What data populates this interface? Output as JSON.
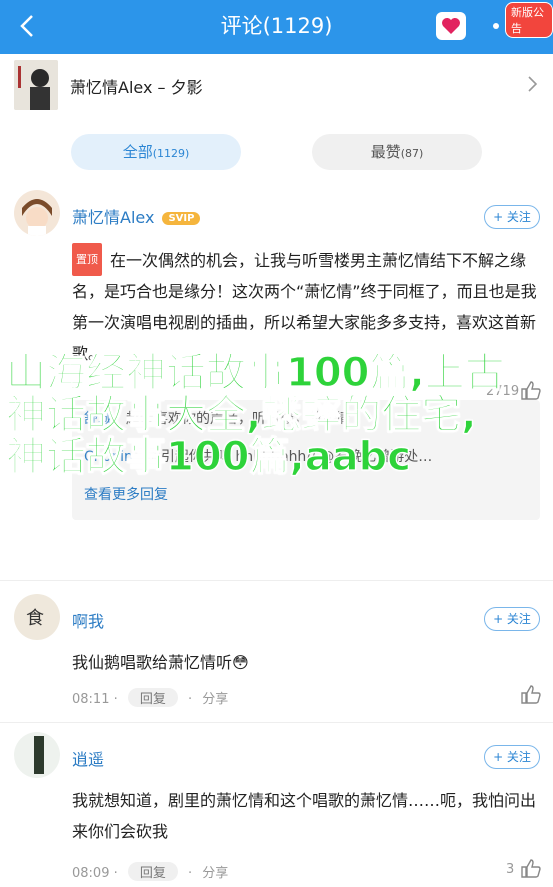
{
  "header": {
    "title": "评论(1129)",
    "badge": "新版公告"
  },
  "song": {
    "title": "萧忆情Alex – 夕影"
  },
  "tabs": [
    {
      "label": "全部",
      "count": "(1129)"
    },
    {
      "label": "最赞",
      "count": "(87)"
    }
  ],
  "comments": [
    {
      "user": "萧忆情Alex",
      "vip": "SVIP",
      "follow": "+ 关注",
      "top_tag": "置顶",
      "text": "在一次偶然的机会，让我与听雪楼男主萧忆情结下不解之缘名，是巧合也是缘分！这次两个“萧忆情”终于同框了，而且也是我第一次演唱电视剧的插曲，所以希望大家能多多支持，喜欢这首新歌。",
      "likes": "2719",
      "reply_user": "舒城",
      "reply_text": "超级喜欢你的声音，听雪楼，萧忆情",
      "reply_user2": "Chopin",
      "reply_text2": "能引起你共鸣 hhhhhhhh// @岁晚忆曾游处…",
      "view_replies": "查看更多回复"
    },
    {
      "user": "啊我",
      "follow": "+ 关注",
      "text": "我仙鹅唱歌给萧忆情听😳",
      "time": "08:11",
      "reply": "回复",
      "share": "分享"
    },
    {
      "user": "逍遥",
      "follow": "+ 关注",
      "text": "我就想知道，剧里的萧忆情和这个唱歌的萧忆情……呃，我怕问出来你们会砍我",
      "time": "08:09",
      "reply": "回复",
      "share": "分享",
      "likes": "3"
    }
  ],
  "overlay_text": "山海经神话故事100篇,上古神话故事大全,蟋蟀的住宅,神话故事100篇,aabc",
  "colors": {
    "header": "#2c95ea",
    "link": "#2c7cc4",
    "overlay": "#2ed33a"
  }
}
